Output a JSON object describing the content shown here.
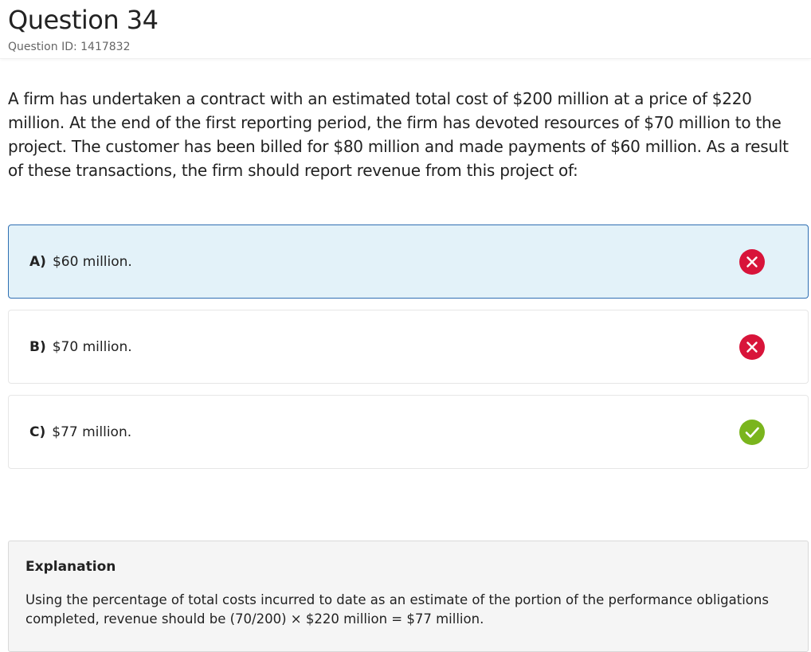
{
  "header": {
    "title": "Question 34",
    "question_id": "Question ID: 1417832"
  },
  "question": {
    "stem": "A firm has undertaken a contract with an estimated total cost of $200 million at a price of $220 million. At the end of the first reporting period, the firm has devoted resources of $70 million to the project. The customer has been billed for $80 million and made payments of $60 million. As a result of these transactions, the firm should report revenue from this project of:"
  },
  "choices": [
    {
      "letter": "A)",
      "text": "$60 million.",
      "selected": true,
      "status": "incorrect",
      "icon": "x-circle-icon"
    },
    {
      "letter": "B)",
      "text": "$70 million.",
      "selected": false,
      "status": "incorrect",
      "icon": "x-circle-icon"
    },
    {
      "letter": "C)",
      "text": "$77 million.",
      "selected": false,
      "status": "correct",
      "icon": "check-circle-icon"
    }
  ],
  "explanation": {
    "title": "Explanation",
    "text": "Using the percentage of total costs incurred to date as an estimate of the portion of the performance obligations completed, revenue should be (70/200) × $220 million = $77 million."
  },
  "colors": {
    "incorrect": "#d8143a",
    "correct": "#7ab51d",
    "selected_bg": "#e3f2f9",
    "selected_border": "#2f6fb3"
  }
}
